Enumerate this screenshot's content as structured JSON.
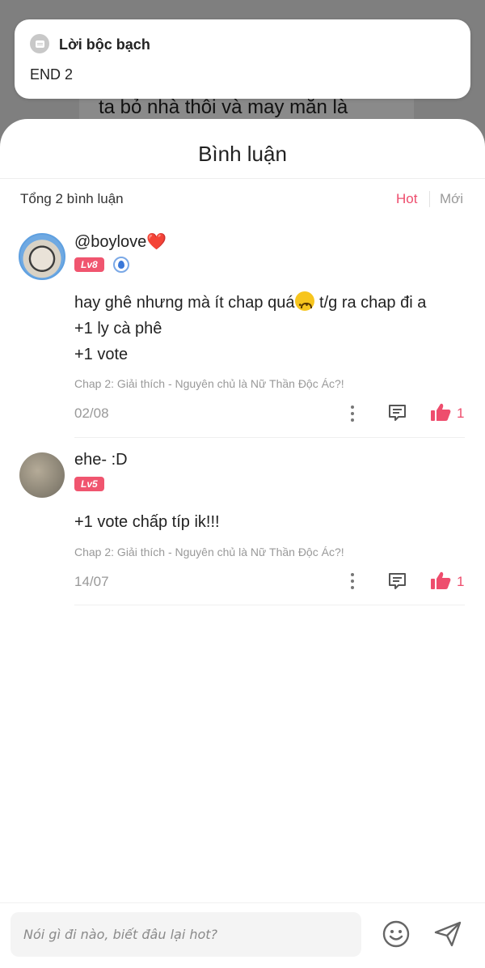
{
  "background": {
    "text": "ta bỏ nhà thôi và may mắn là"
  },
  "notification": {
    "title": "Lời bộc bạch",
    "body": "END 2",
    "icon": "message-icon"
  },
  "sheet": {
    "title": "Bình luận",
    "total_label": "Tổng 2 bình luận",
    "sort": {
      "hot": "Hot",
      "new": "Mới",
      "active": "hot"
    }
  },
  "comments": [
    {
      "username": "@boylove",
      "username_suffix": "❤️",
      "level": "Lv8",
      "verified": true,
      "lines": [
        "hay ghê nhưng mà ít chap quá",
        "t/g ra chap đi a",
        "+1 ly cà phê",
        "+1 vote"
      ],
      "chapter": "Chap 2: Giải thích - Nguyên chủ là Nữ Thần Độc Ác?!",
      "date": "02/08",
      "likes": "1"
    },
    {
      "username": "ehe- :D",
      "level": "Lv5",
      "verified": false,
      "lines": [
        "+1 vote chấp típ ik!!!"
      ],
      "chapter": "Chap 2: Giải thích - Nguyên chủ là Nữ Thần Độc Ác?!",
      "date": "14/07",
      "likes": "1"
    }
  ],
  "input": {
    "placeholder": "Nói gì đi nào, biết đâu lại hot?"
  },
  "colors": {
    "accent": "#ee4d6d",
    "level_badge": "#f0556f",
    "muted": "#999999"
  }
}
